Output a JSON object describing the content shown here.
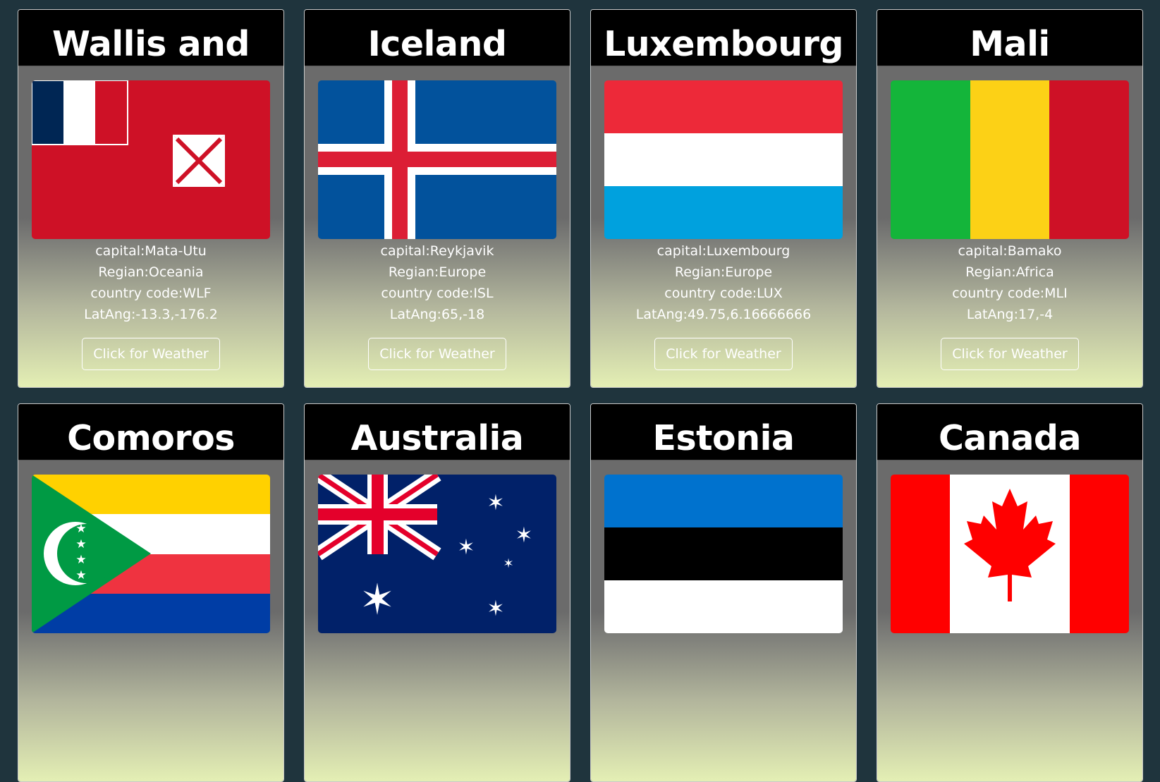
{
  "cards": [
    {
      "name": "Wallis and",
      "capital": "capital:Mata-Utu",
      "region": "Regian:Oceania",
      "code": "country code:WLF",
      "latlng": "LatAng:-13.3,-176.2",
      "button": "Click for Weather",
      "flag_icon": "wallis-and-futuna-flag-icon"
    },
    {
      "name": "Iceland",
      "capital": "capital:Reykjavik",
      "region": "Regian:Europe",
      "code": "country code:ISL",
      "latlng": "LatAng:65,-18",
      "button": "Click for Weather",
      "flag_icon": "iceland-flag-icon"
    },
    {
      "name": "Luxembourg",
      "capital": "capital:Luxembourg",
      "region": "Regian:Europe",
      "code": "country code:LUX",
      "latlng": "LatAng:49.75,6.16666666",
      "button": "Click for Weather",
      "flag_icon": "luxembourg-flag-icon"
    },
    {
      "name": "Mali",
      "capital": "capital:Bamako",
      "region": "Regian:Africa",
      "code": "country code:MLI",
      "latlng": "LatAng:17,-4",
      "button": "Click for Weather",
      "flag_icon": "mali-flag-icon"
    },
    {
      "name": "Comoros",
      "flag_icon": "comoros-flag-icon"
    },
    {
      "name": "Australia",
      "flag_icon": "australia-flag-icon"
    },
    {
      "name": "Estonia",
      "flag_icon": "estonia-flag-icon"
    },
    {
      "name": "Canada",
      "flag_icon": "canada-flag-icon"
    }
  ],
  "colors": {
    "page_background": "#1f343d",
    "card_header": "#000000",
    "card_gradient_top": "#6b6b6b",
    "card_gradient_bottom": "#e4efb4"
  }
}
